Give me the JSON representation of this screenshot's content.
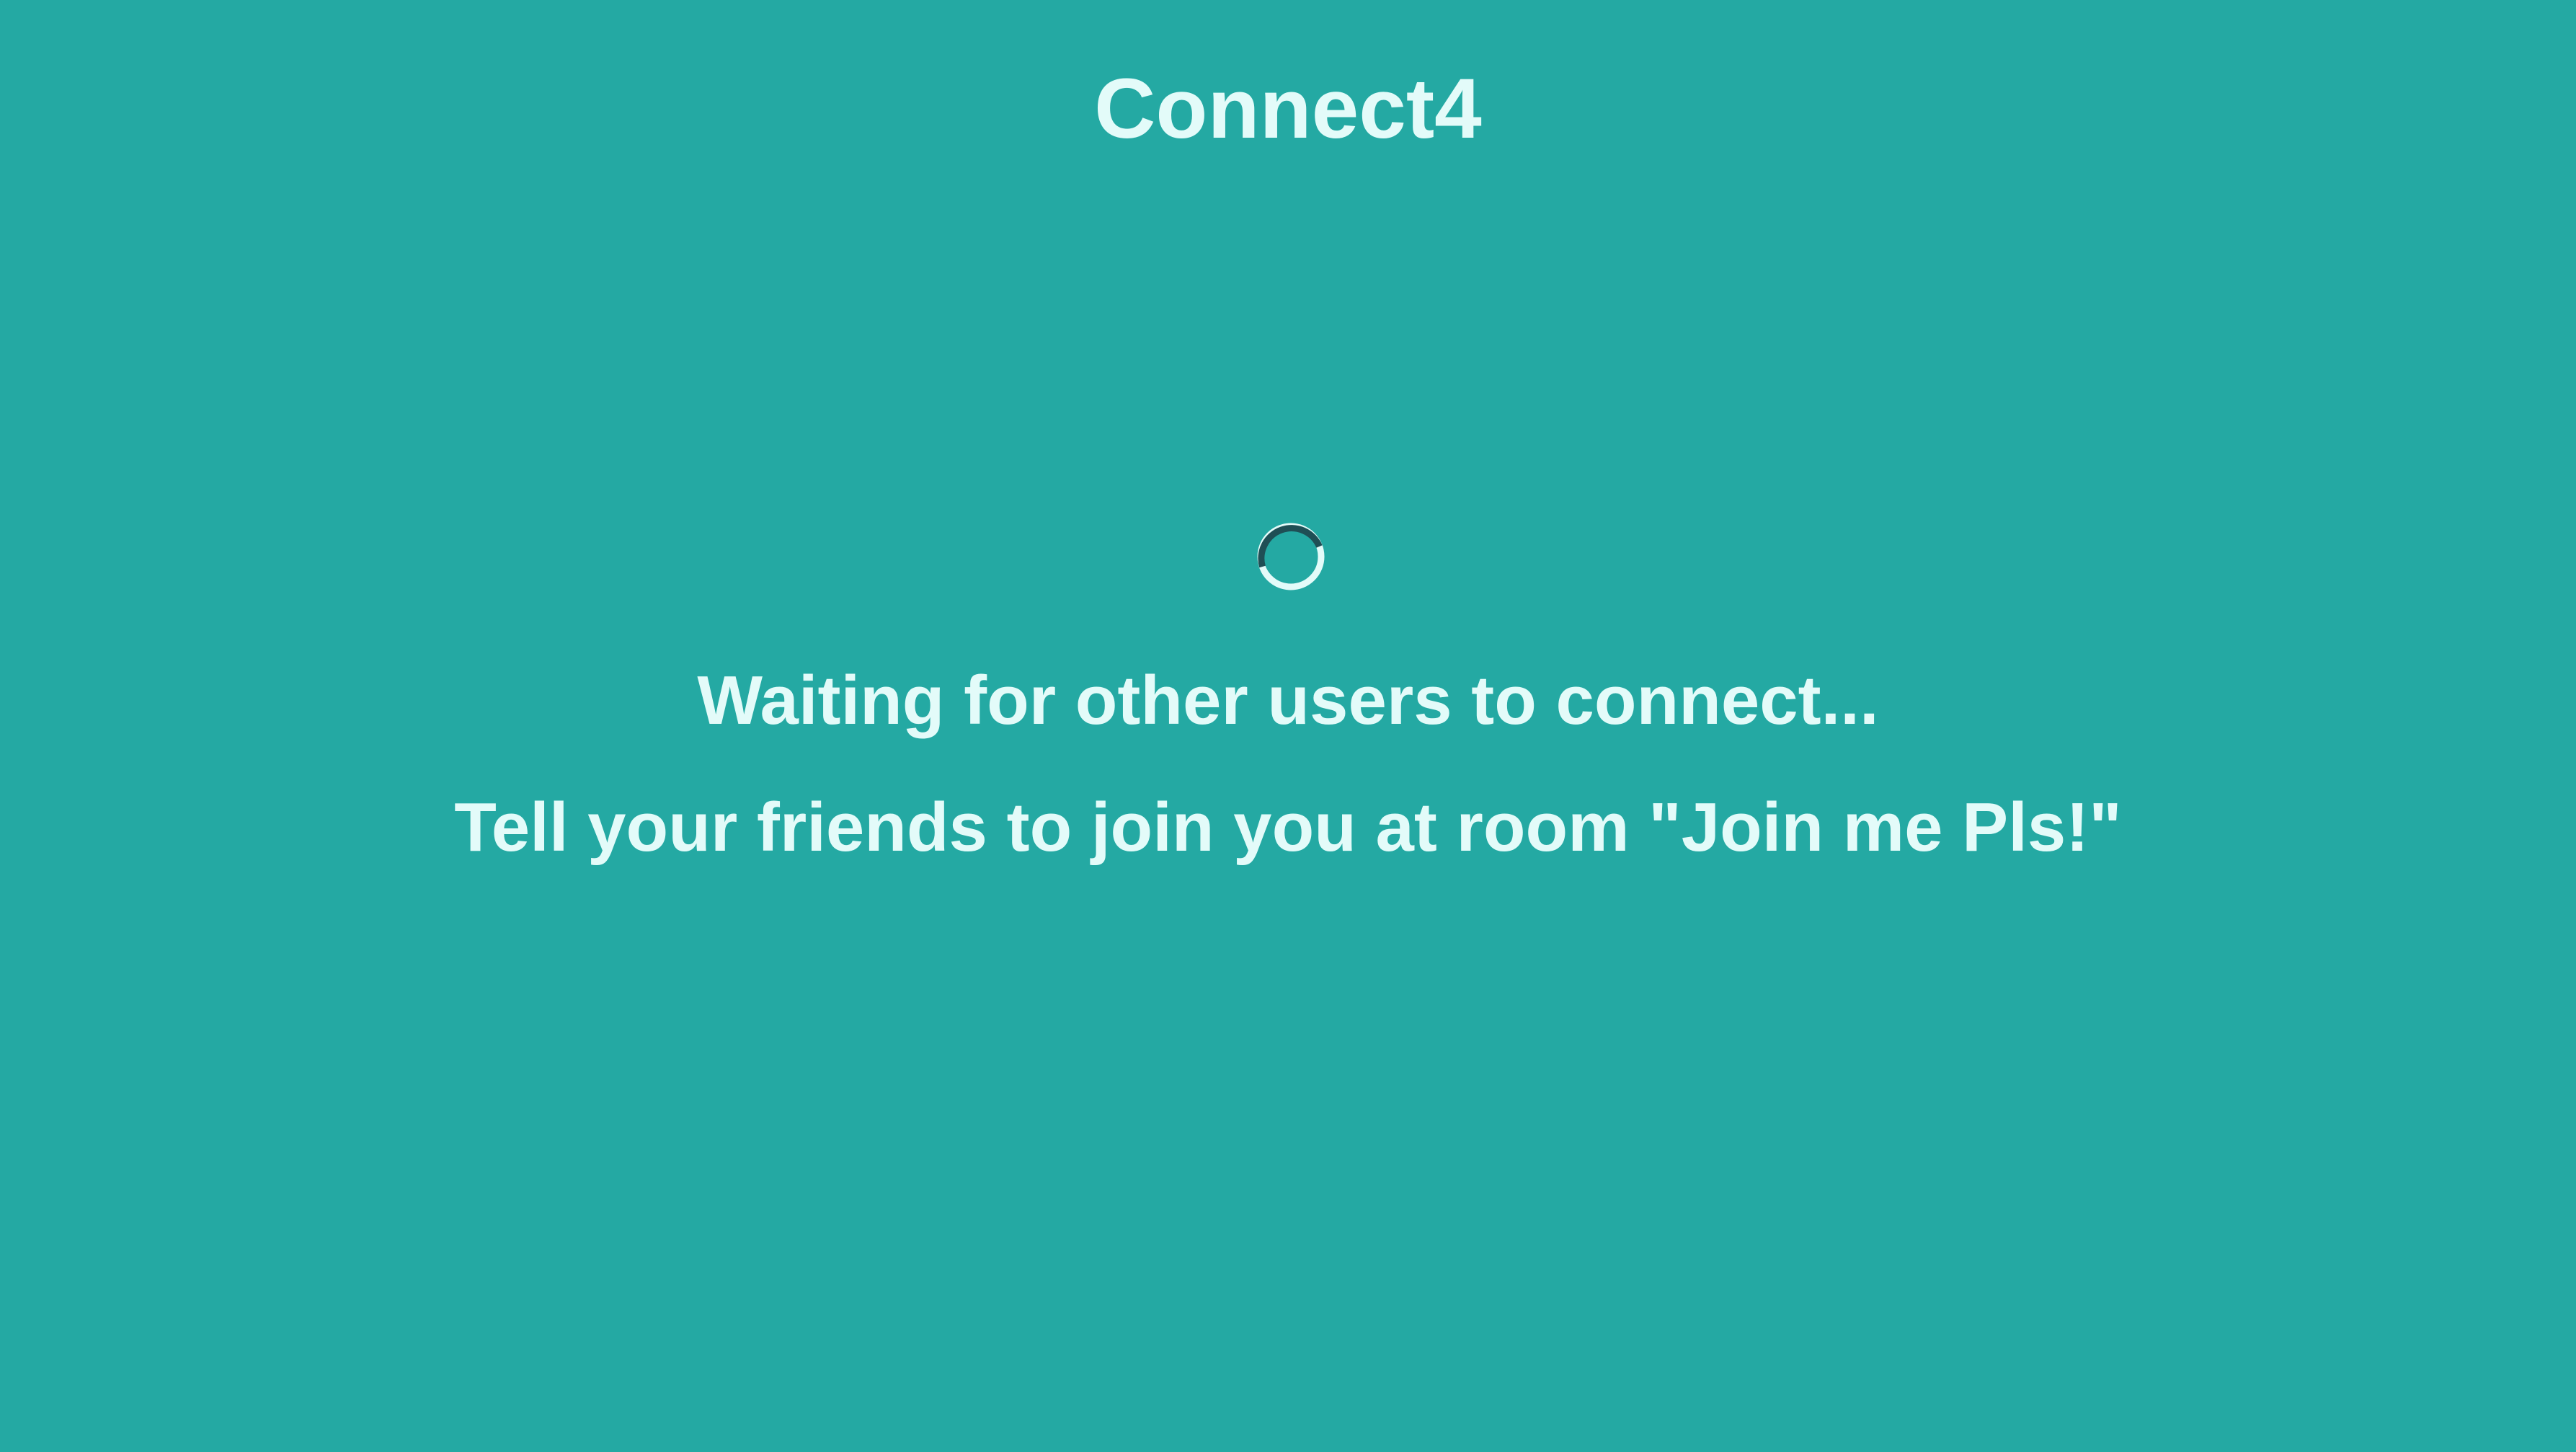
{
  "app": {
    "title": "Connect4"
  },
  "status": {
    "waiting_text": "Waiting for other users to connect...",
    "room_text": "Tell your friends to join you at room \"Join me Pls!\""
  },
  "spinner": {
    "icon": "loading-spinner-icon",
    "track_color": "#e3fbf9",
    "arc_color": "#1f4f55"
  },
  "colors": {
    "background": "#24a9a3",
    "text": "#e3fbf9"
  }
}
